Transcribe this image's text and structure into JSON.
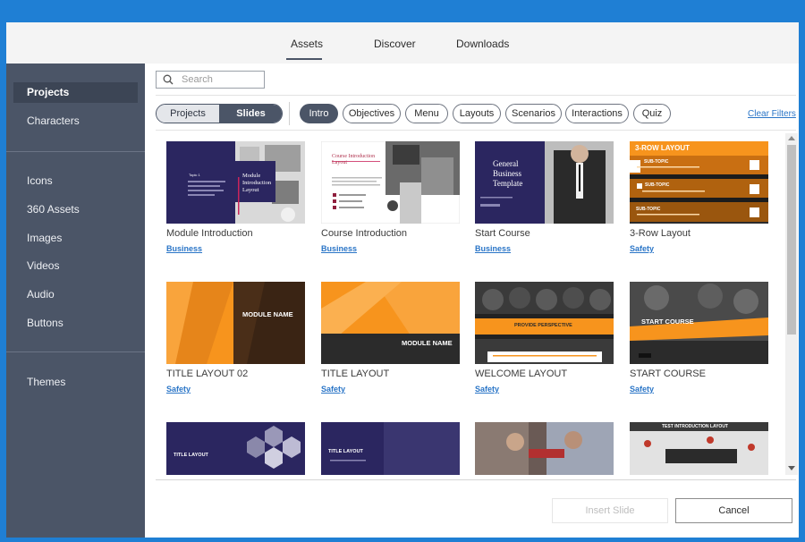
{
  "tabs": {
    "assets": "Assets",
    "discover": "Discover",
    "downloads": "Downloads"
  },
  "sidebar": {
    "items": [
      {
        "label": "Projects"
      },
      {
        "label": "Characters"
      },
      {
        "label": "Icons"
      },
      {
        "label": "360 Assets"
      },
      {
        "label": "Images"
      },
      {
        "label": "Videos"
      },
      {
        "label": "Audio"
      },
      {
        "label": "Buttons"
      },
      {
        "label": "Themes"
      }
    ]
  },
  "search": {
    "placeholder": "Search"
  },
  "toggle": {
    "projects": "Projects",
    "slides": "Slides"
  },
  "filters": [
    {
      "label": "Intro"
    },
    {
      "label": "Objectives"
    },
    {
      "label": "Menu"
    },
    {
      "label": "Layouts"
    },
    {
      "label": "Scenarios"
    },
    {
      "label": "Interactions"
    },
    {
      "label": "Quiz"
    }
  ],
  "clear_filters": "Clear Filters",
  "cards": [
    {
      "title": "Module Introduction",
      "tag": "Business",
      "thumb": {
        "heading": "Module Introduction Layout",
        "small": "Topic 1"
      }
    },
    {
      "title": "Course Introduction",
      "tag": "Business",
      "thumb": {
        "heading": "Course Introduction Layout"
      }
    },
    {
      "title": "Start Course",
      "tag": "Business",
      "thumb": {
        "heading": "General Business Template"
      }
    },
    {
      "title": "3-Row Layout",
      "tag": "Safety",
      "thumb": {
        "heading": "3-ROW LAYOUT",
        "rows": [
          "SUB-TOPIC",
          "SUB-TOPIC",
          "SUB-TOPIC"
        ]
      }
    },
    {
      "title": "TITLE LAYOUT 02",
      "tag": "Safety",
      "thumb": {
        "heading": "MODULE NAME"
      }
    },
    {
      "title": "TITLE LAYOUT",
      "tag": "Safety",
      "thumb": {
        "heading": "MODULE NAME"
      }
    },
    {
      "title": "WELCOME LAYOUT",
      "tag": "Safety",
      "thumb": {
        "heading": "PROVIDE PERSPECTIVE"
      }
    },
    {
      "title": "START COURSE",
      "tag": "Safety",
      "thumb": {
        "heading": "START COURSE"
      }
    },
    {
      "title": "",
      "tag": "",
      "thumb": {
        "heading": "TITLE LAYOUT"
      }
    },
    {
      "title": "",
      "tag": "",
      "thumb": {
        "heading": "TITLE LAYOUT"
      }
    },
    {
      "title": "",
      "tag": "",
      "thumb": {
        "heading": ""
      }
    },
    {
      "title": "",
      "tag": "",
      "thumb": {
        "heading": "TEST INTRODUCTION LAYOUT"
      }
    }
  ],
  "buttons": {
    "insert": "Insert Slide",
    "cancel": "Cancel"
  },
  "colors": {
    "frame": "#1f7fd4",
    "sidebar": "#4b5567",
    "accent_link": "#2a75c7",
    "safety_orange": "#f7941d",
    "business_navy": "#2b2660"
  }
}
